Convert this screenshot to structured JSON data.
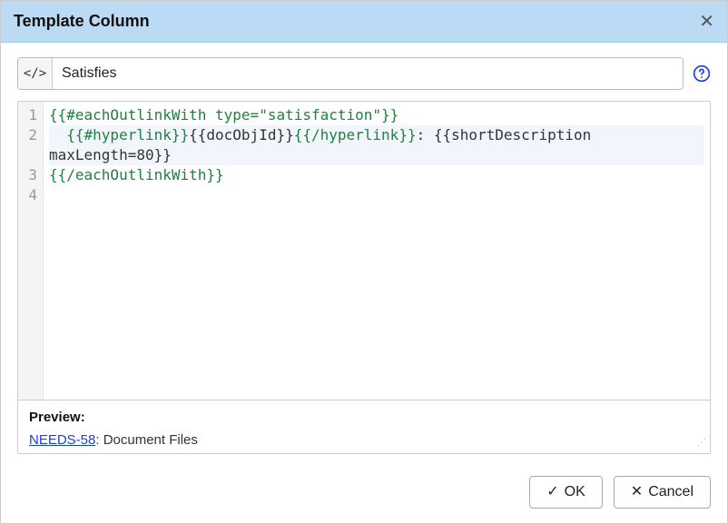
{
  "dialog": {
    "title": "Template Column"
  },
  "column": {
    "name": "Satisfies"
  },
  "editor": {
    "gutter": [
      "1",
      "2",
      "",
      "3",
      "4"
    ],
    "lines": [
      {
        "text": "{{#eachOutlinkWith type=\"satisfaction\"}}",
        "cls": ""
      },
      {
        "text": "  {{#hyperlink}}{{docObjId}}{{/hyperlink}}: {{shortDescription maxLength=80}}",
        "cls": "active"
      },
      {
        "text": "{{/eachOutlinkWith}}",
        "cls": ""
      },
      {
        "text": "",
        "cls": ""
      }
    ]
  },
  "preview": {
    "label": "Preview:",
    "link_text": "NEEDS-58",
    "rest": ": Document Files"
  },
  "buttons": {
    "ok": "OK",
    "cancel": "Cancel"
  },
  "icons": {
    "code": "</>",
    "check": "✓",
    "cross": "✕",
    "close": "✕"
  }
}
